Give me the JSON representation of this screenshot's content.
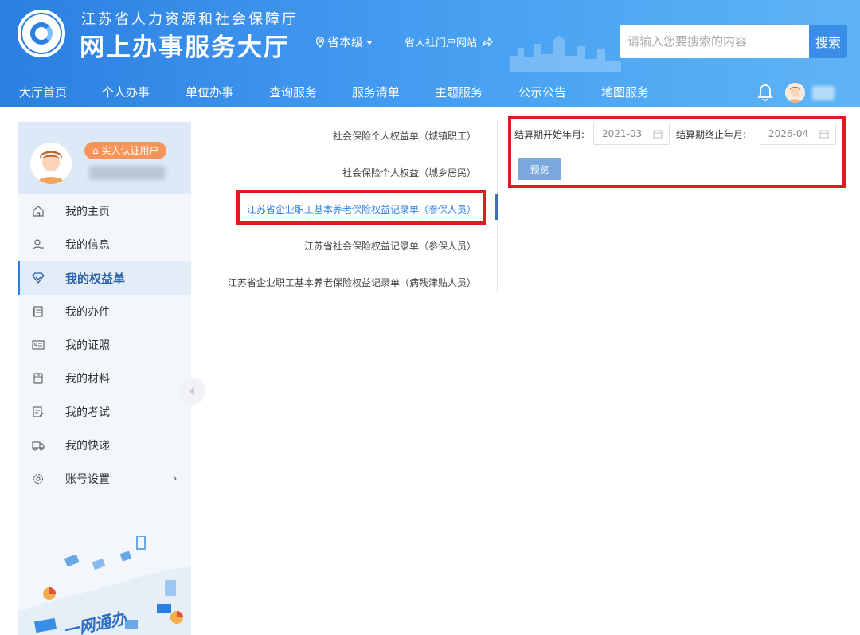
{
  "header": {
    "subtitle": "江苏省人力资源和社会保障厅",
    "title": "网上办事服务大厅",
    "region": "省本级",
    "portal_link": "省人社门户网站",
    "search": {
      "placeholder": "请输入您要搜索的内容",
      "button": "搜索"
    },
    "nav": [
      "大厅首页",
      "个人办事",
      "单位办事",
      "查询服务",
      "服务清单",
      "主题服务",
      "公示公告",
      "地图服务"
    ]
  },
  "sidebar": {
    "badge": "实人认证用户",
    "menu": [
      {
        "label": "我的主页",
        "icon": "home-icon"
      },
      {
        "label": "我的信息",
        "icon": "user-icon"
      },
      {
        "label": "我的权益单",
        "icon": "heart-shield-icon",
        "active": true
      },
      {
        "label": "我的办件",
        "icon": "document-icon"
      },
      {
        "label": "我的证照",
        "icon": "id-card-icon"
      },
      {
        "label": "我的材料",
        "icon": "folder-icon"
      },
      {
        "label": "我的考试",
        "icon": "exam-icon"
      },
      {
        "label": "我的快递",
        "icon": "truck-icon"
      },
      {
        "label": "账号设置",
        "icon": "gear-icon",
        "has_arrow": true
      }
    ],
    "illustration_text": "一网通办"
  },
  "documents": [
    {
      "label": "社会保险个人权益单（城镇职工）"
    },
    {
      "label": "社会保险个人权益（城乡居民）"
    },
    {
      "label": "江苏省企业职工基本养老保险权益记录单（参保人员）",
      "active": true
    },
    {
      "label": "江苏省社会保险权益记录单（参保人员）"
    },
    {
      "label": "江苏省企业职工基本养老保险权益记录单（病残津贴人员）"
    }
  ],
  "filter": {
    "start_label": "结算期开始年月:",
    "start_value": "2021-03",
    "end_label": "结算期终止年月:",
    "end_value": "2026-04",
    "preview_button": "预览"
  },
  "colors": {
    "primary": "#2b7fe0",
    "highlight_border": "#e01c22",
    "badge": "#f7945a"
  }
}
